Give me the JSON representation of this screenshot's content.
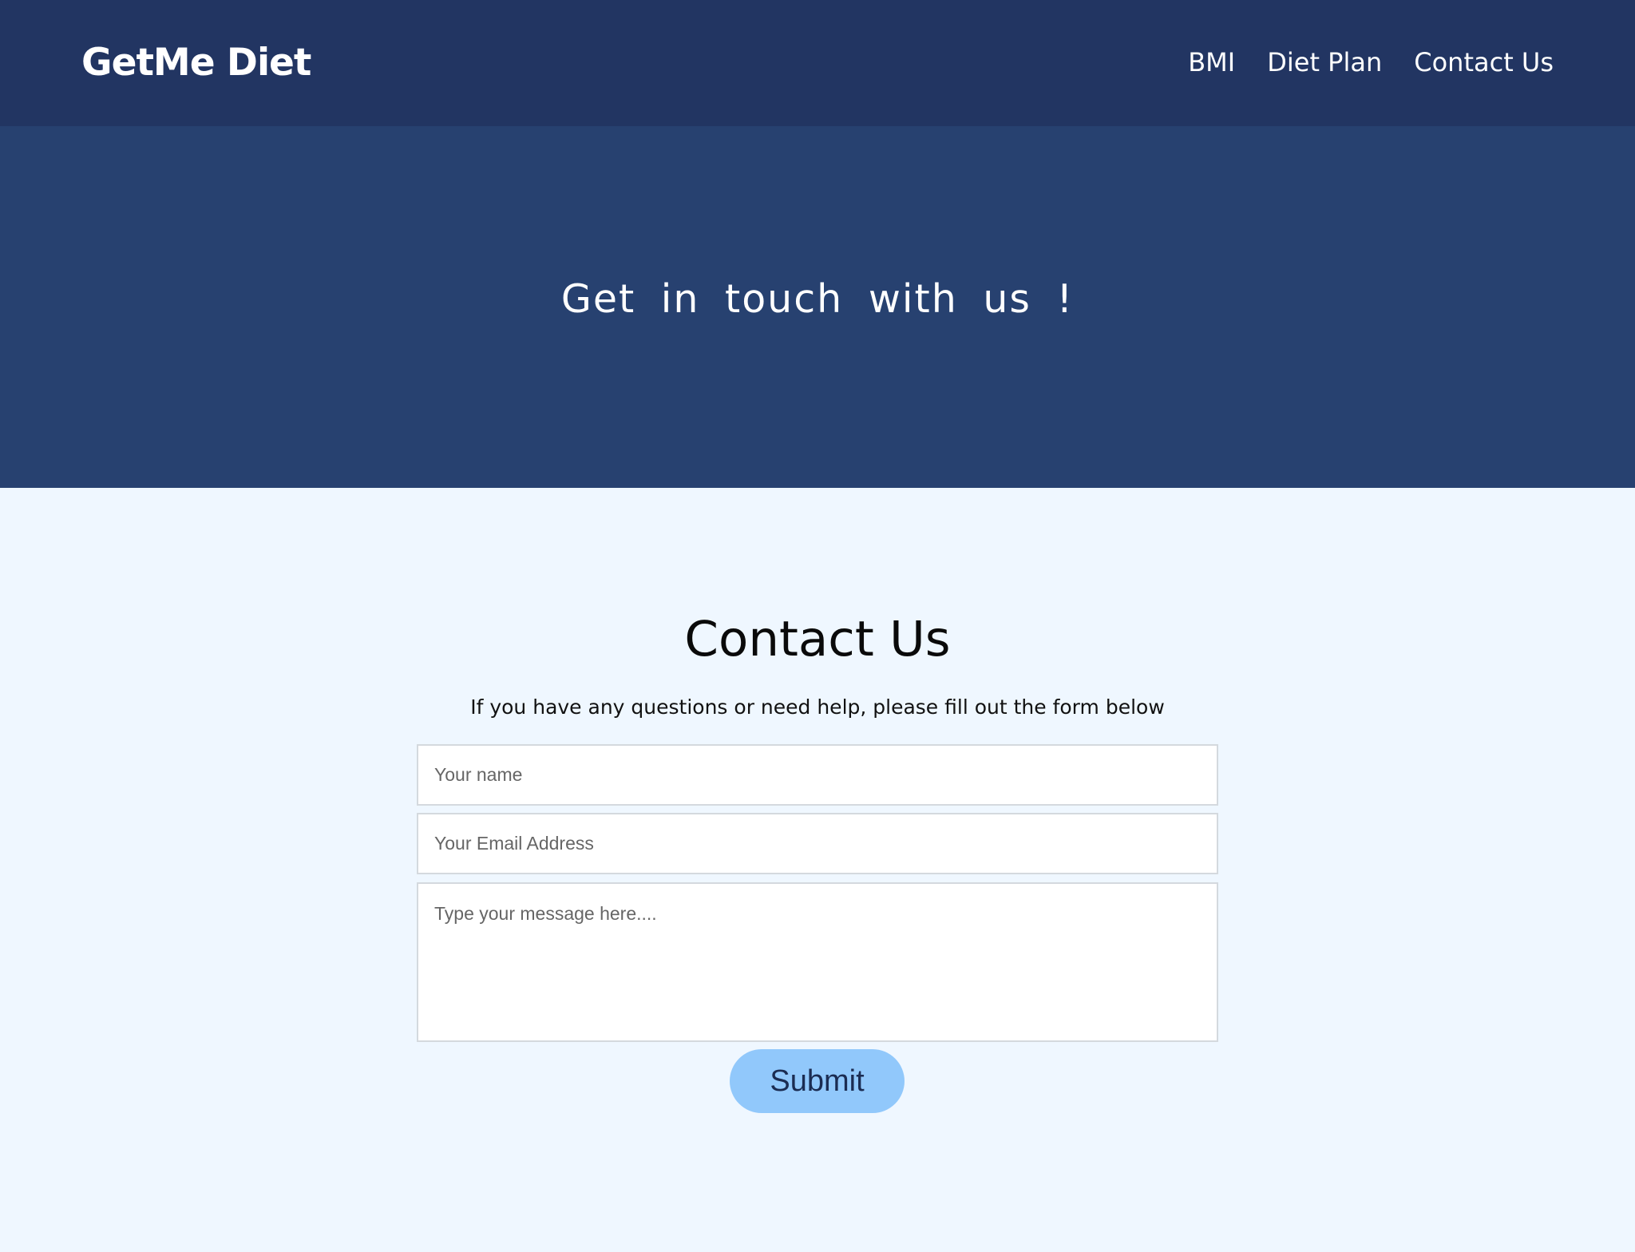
{
  "navbar": {
    "brand": "GetMe Diet",
    "links": [
      {
        "label": "BMI"
      },
      {
        "label": "Diet Plan"
      },
      {
        "label": "Contact Us"
      }
    ]
  },
  "hero": {
    "title": "Get in touch with us !"
  },
  "contact": {
    "title": "Contact Us",
    "subtitle": "If you have any questions or need help, please fill out the form below",
    "name_placeholder": "Your name",
    "email_placeholder": "Your Email Address",
    "message_placeholder": "Type your message here....",
    "submit_label": "Submit"
  },
  "colors": {
    "navbar_bg": "#223562",
    "hero_bg": "#274170",
    "page_bg": "#eff7ff",
    "button_bg": "#91c8fb",
    "button_text": "#1b2c52"
  }
}
